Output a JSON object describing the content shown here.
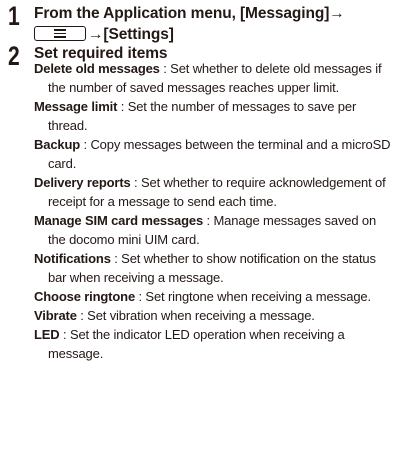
{
  "step1": {
    "number": "1",
    "title_prefix": "From the Application menu, [Messaging]→",
    "menu_key_icon": "menu-key-icon",
    "title_suffix": "→[Settings]"
  },
  "step2": {
    "number": "2",
    "title": "Set required items",
    "items": [
      {
        "term": "Delete old messages",
        "desc": " : Set whether to delete old messages if the number of saved messages reaches upper limit."
      },
      {
        "term": "Message limit",
        "desc": " : Set the number of messages to save per thread."
      },
      {
        "term": "Backup",
        "desc": " : Copy messages between the terminal and a microSD card."
      },
      {
        "term": "Delivery reports",
        "desc": " : Set whether to require acknowledgement of receipt for a message to send each time."
      },
      {
        "term": "Manage SIM card messages",
        "desc": " : Manage messages saved on the docomo mini UIM card."
      },
      {
        "term": "Notifications",
        "desc": " : Set whether to show notification on the status bar when receiving a message."
      },
      {
        "term": "Choose ringtone",
        "desc": " : Set ringtone when receiving a message."
      },
      {
        "term": "Vibrate",
        "desc": " : Set vibration when receiving a message."
      },
      {
        "term": "LED",
        "desc": " : Set the indicator LED operation when receiving a message."
      }
    ]
  }
}
